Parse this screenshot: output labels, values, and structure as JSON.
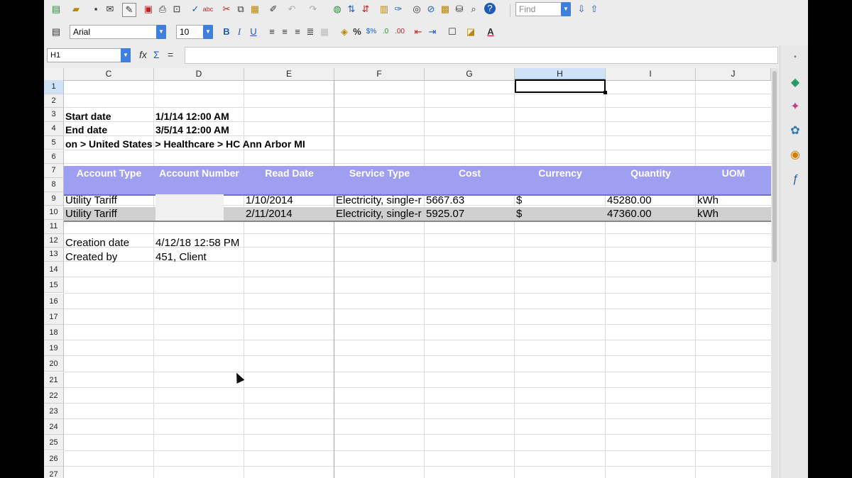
{
  "toolbar": {
    "find_placeholder": "Find",
    "font_name": "Arial",
    "font_size": "10",
    "bold_label": "B",
    "italic_label": "I",
    "underline_label": "U",
    "percent_label": "%"
  },
  "formula_bar": {
    "cell_ref": "H1",
    "function_wizard_label": "fx",
    "sum_label": "Σ",
    "equals_label": "=",
    "content": ""
  },
  "columns": [
    "C",
    "D",
    "E",
    "F",
    "G",
    "H",
    "I",
    "J"
  ],
  "selected_column": "H",
  "rows": [
    "1",
    "2",
    "3",
    "4",
    "5",
    "6",
    "7",
    "8",
    "9",
    "10",
    "11",
    "12",
    "13",
    "14",
    "15",
    "16",
    "17",
    "18",
    "19",
    "20",
    "21",
    "22",
    "23",
    "24",
    "25",
    "26",
    "27"
  ],
  "cells": {
    "start_label": "Start date",
    "start_value": "1/1/14 12:00 AM",
    "end_label": "End date",
    "end_value": "3/5/14 12:00 AM",
    "path": "on > United States > Healthcare > HC Ann Arbor MI",
    "creation_label": "Creation date",
    "creation_value": "4/12/18 12:58 PM",
    "created_by_label": "Created by",
    "created_by_value": "451, Client"
  },
  "table": {
    "headers": [
      "Account Type",
      "Account Number",
      "Read Date",
      "Service Type",
      "Cost",
      "Currency",
      "Quantity",
      "UOM"
    ],
    "rows": [
      {
        "account_type": "Utility Tariff",
        "read_date": "1/10/2014",
        "service_type": "Electricity, single-r",
        "cost": "5667.63",
        "currency": "$",
        "quantity": "45280.00",
        "uom": "kWh"
      },
      {
        "account_type": "Utility Tariff",
        "read_date": "2/11/2014",
        "service_type": "Electricity, single-r",
        "cost": "5925.07",
        "currency": "$",
        "quantity": "47360.00",
        "uom": "kWh"
      }
    ]
  },
  "colors": {
    "header_band": "#9f9ff1",
    "selected_row": "#cfcfcf",
    "accent": "#3f7fde"
  }
}
